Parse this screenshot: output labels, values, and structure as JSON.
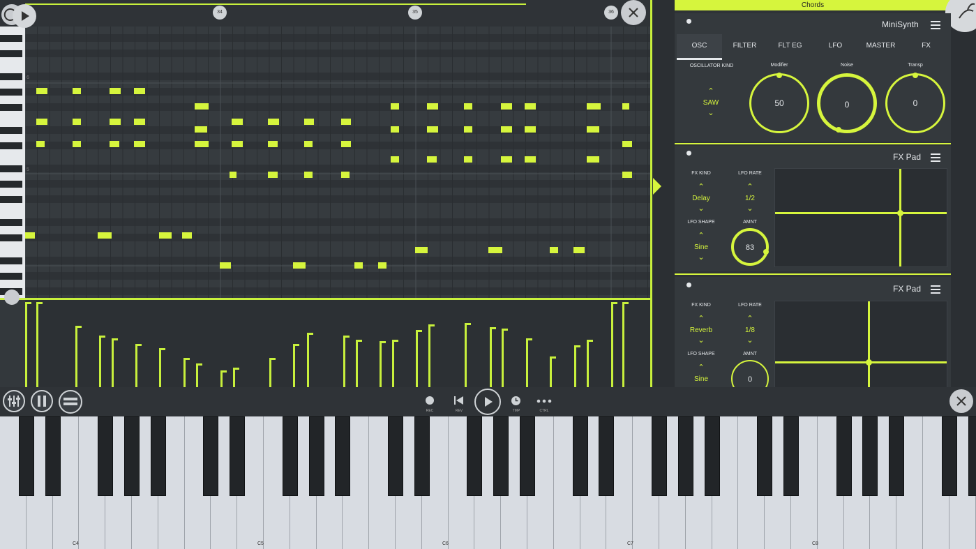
{
  "piano_roll": {
    "timeline_markers": [
      "34",
      "35",
      "36"
    ],
    "octave_labels": [
      "6",
      "5"
    ],
    "play_icon": "play-icon",
    "close_icon": "close-icon"
  },
  "right_panel": {
    "header": "Chords",
    "minisynth": {
      "title": "MiniSynth",
      "tabs": [
        "OSC",
        "FILTER",
        "FLT EG",
        "LFO",
        "MASTER",
        "FX"
      ],
      "active_tab": "OSC",
      "osc_kind_label": "OSCILLATOR KIND",
      "osc_kind_value": "SAW",
      "knobs": [
        {
          "label": "Modifier",
          "value": "50"
        },
        {
          "label": "Noise",
          "value": "0"
        },
        {
          "label": "Transp",
          "value": "0"
        }
      ]
    },
    "fxpad1": {
      "title": "FX Pad",
      "fx_kind_label": "FX KIND",
      "fx_kind_value": "Delay",
      "lfo_rate_label": "LFO RATE",
      "lfo_rate_value": "1/2",
      "lfo_shape_label": "LFO SHAPE",
      "lfo_shape_value": "Sine",
      "amnt_label": "AMNT",
      "amnt_value": "83"
    },
    "fxpad2": {
      "title": "FX Pad",
      "fx_kind_label": "FX KIND",
      "fx_kind_value": "Reverb",
      "lfo_rate_label": "LFO RATE",
      "lfo_rate_value": "1/8",
      "lfo_shape_label": "LFO SHAPE",
      "lfo_shape_value": "Sine",
      "amnt_label": "AMNT",
      "amnt_value": "0"
    }
  },
  "transport": {
    "rec": "REC",
    "rev": "REV",
    "tmp": "TMP",
    "ctrl": "CTRL"
  },
  "keyboard": {
    "octave_labels": [
      "C4",
      "C5",
      "C6",
      "C7",
      "C8"
    ]
  },
  "colors": {
    "accent": "#d6f53d",
    "background": "#2b2f33"
  }
}
